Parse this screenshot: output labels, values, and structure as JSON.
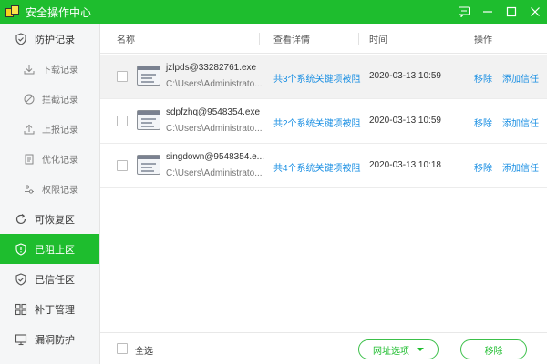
{
  "window": {
    "title": "安全操作中心"
  },
  "sidebar": {
    "items": [
      {
        "label": "防护记录",
        "icon": "shield-check-icon",
        "type": "main"
      },
      {
        "label": "下载记录",
        "icon": "download-icon",
        "type": "sub"
      },
      {
        "label": "拦截记录",
        "icon": "block-icon",
        "type": "sub"
      },
      {
        "label": "上报记录",
        "icon": "upload-icon",
        "type": "sub"
      },
      {
        "label": "优化记录",
        "icon": "document-icon",
        "type": "sub"
      },
      {
        "label": "权限记录",
        "icon": "sliders-icon",
        "type": "sub"
      },
      {
        "label": "可恢复区",
        "icon": "restore-icon",
        "type": "main"
      },
      {
        "label": "已阻止区",
        "icon": "shield-alert-icon",
        "type": "main",
        "active": true
      },
      {
        "label": "已信任区",
        "icon": "shield-trust-icon",
        "type": "main"
      },
      {
        "label": "补丁管理",
        "icon": "grid-icon",
        "type": "main"
      },
      {
        "label": "漏洞防护",
        "icon": "monitor-icon",
        "type": "main"
      }
    ]
  },
  "table": {
    "headers": {
      "name": "名称",
      "detail": "查看详情",
      "time": "时间",
      "action": "操作"
    },
    "rows": [
      {
        "name": "jzlpds@33282761.exe",
        "path": "C:\\Users\\Administrato...",
        "detail": "共3个系统关键项被阻",
        "time": "2020-03-13 10:59",
        "remove": "移除",
        "trust": "添加信任"
      },
      {
        "name": "sdpfzhq@9548354.exe",
        "path": "C:\\Users\\Administrato...",
        "detail": "共2个系统关键项被阻",
        "time": "2020-03-13 10:59",
        "remove": "移除",
        "trust": "添加信任"
      },
      {
        "name": "singdown@9548354.e...",
        "path": "C:\\Users\\Administrato...",
        "detail": "共4个系统关键项被阻",
        "time": "2020-03-13 10:18",
        "remove": "移除",
        "trust": "添加信任"
      }
    ]
  },
  "footer": {
    "select_all": "全选",
    "url_options": "网址选项",
    "remove": "移除"
  },
  "colors": {
    "accent": "#1ebd2e",
    "link": "#1a8fe3"
  }
}
